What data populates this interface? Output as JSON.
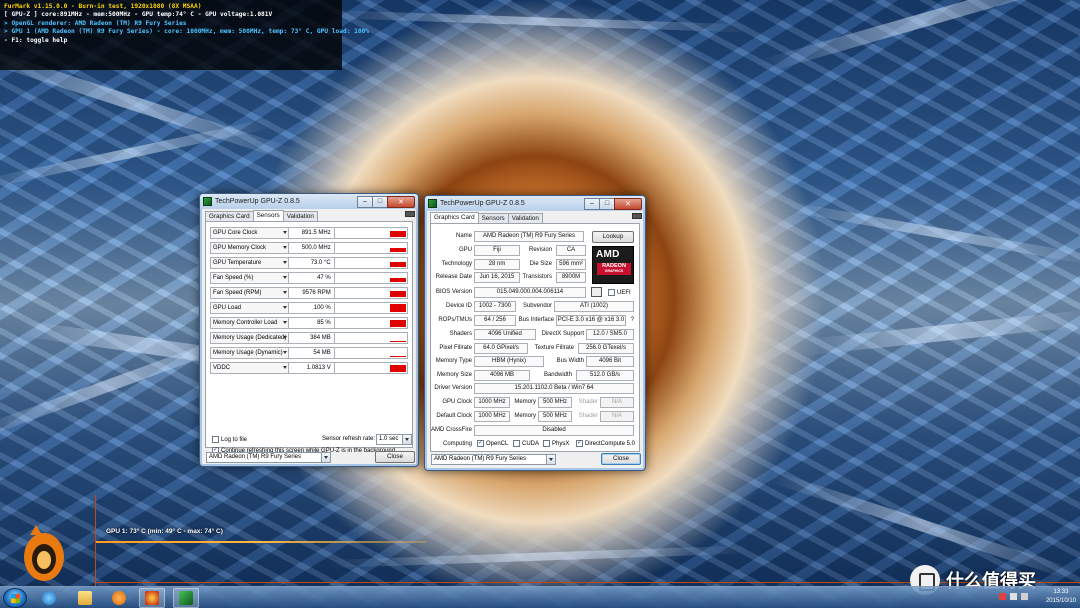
{
  "furmark": {
    "title": "FurMark v1.15.0.0 - Burn-in test, 1920x1080 (8X MSAA)",
    "line_gpuz": "[ GPU-Z ] core:891MHz - mem:500MHz - GPU temp:74° C - GPU voltage:1.081V",
    "line_renderer": "> OpenGL renderer: AMD Radeon (TM) R9 Fury Series",
    "line_gpu1": "> GPU 1 (AMD Radeon (TM) R9 Fury Series) - core: 1000MHz, mem: 500MHz, temp: 73° C, GPU load: 100%",
    "line_help": "- F1: toggle help",
    "graph_label": "GPU 1: 73° C (min: 49° C - max: 74° C)"
  },
  "gpuz_sensors": {
    "title": "TechPowerUp GPU-Z 0.8.5",
    "tabs": [
      "Graphics Card",
      "Sensors",
      "Validation"
    ],
    "active_tab": "Sensors",
    "rows": [
      {
        "name": "GPU Core Clock",
        "value": "891.5 MHz",
        "level": 0.75
      },
      {
        "name": "GPU Memory Clock",
        "value": "500.0 MHz",
        "level": 0.55
      },
      {
        "name": "GPU Temperature",
        "value": "73.0 °C",
        "level": 0.6
      },
      {
        "name": "Fan Speed (%)",
        "value": "47 %",
        "level": 0.5
      },
      {
        "name": "Fan Speed (RPM)",
        "value": "9576 RPM",
        "level": 0.8
      },
      {
        "name": "GPU Load",
        "value": "100 %",
        "level": 1.0
      },
      {
        "name": "Memory Controller Load",
        "value": "85 %",
        "level": 0.9
      },
      {
        "name": "Memory Usage (Dedicated)",
        "value": "384 MB",
        "level": 0.1
      },
      {
        "name": "Memory Usage (Dynamic)",
        "value": "54 MB",
        "level": 0.05
      },
      {
        "name": "VDDC",
        "value": "1.0813 V",
        "level": 0.85
      }
    ],
    "log_to_file": "Log to file",
    "refresh_label": "Sensor refresh rate:",
    "refresh_value": "1.0 sec",
    "continue_refresh": "Continue refreshing this screen while GPU-Z is in the background",
    "device_select": "AMD Radeon (TM) R9 Fury Series",
    "close_label": "Close"
  },
  "gpuz_card": {
    "title": "TechPowerUp GPU-Z 0.8.5",
    "tabs": [
      "Graphics Card",
      "Sensors",
      "Validation"
    ],
    "active_tab": "Graphics Card",
    "name_label": "Name",
    "name_value": "AMD Radeon (TM) R9 Fury Series",
    "lookup_label": "Lookup",
    "gpu_label": "GPU",
    "gpu_value": "Fiji",
    "revision_label": "Revision",
    "revision_value": "CA",
    "technology_label": "Technology",
    "technology_value": "28 nm",
    "diesize_label": "Die Size",
    "diesize_value": "596 mm²",
    "release_label": "Release Date",
    "release_value": "Jun 16, 2015",
    "transistors_label": "Transistors",
    "transistors_value": "8900M",
    "bios_label": "BIOS Version",
    "bios_value": "015.049.000.004.006114",
    "uefi_label": "UEFI",
    "deviceid_label": "Device ID",
    "deviceid_value": "1002 - 7300",
    "subvendor_label": "Subvendor",
    "subvendor_value": "ATI (1002)",
    "rops_label": "ROPs/TMUs",
    "rops_value": "64 / 256",
    "businterface_label": "Bus Interface",
    "businterface_value": "PCI-E 3.0 x16 @ x16 3.0",
    "question_mark": "?",
    "shaders_label": "Shaders",
    "shaders_value": "4096 Unified",
    "directx_label": "DirectX Support",
    "directx_value": "12.0 / SM5.0",
    "pixelfill_label": "Pixel Fillrate",
    "pixelfill_value": "64.0 GPixel/s",
    "texturefill_label": "Texture Fillrate",
    "texturefill_value": "256.0 GTexel/s",
    "memtype_label": "Memory Type",
    "memtype_value": "HBM (Hynix)",
    "buswidth_label": "Bus Width",
    "buswidth_value": "4096 Bit",
    "memsize_label": "Memory Size",
    "memsize_value": "4096 MB",
    "bandwidth_label": "Bandwidth",
    "bandwidth_value": "512.0 GB/s",
    "driver_label": "Driver Version",
    "driver_value": "15.201.1102.0 Beta / Win7 64",
    "gpuclock_label": "GPU Clock",
    "gpuclock_value": "1000 MHz",
    "memory_label": "Memory",
    "gpuclock_mem_value": "500 MHz",
    "shader_label": "Shader",
    "na_value": "N/A",
    "defaultclock_label": "Default Clock",
    "defaultclock_value": "1000 MHz",
    "defaultclock_mem_value": "500 MHz",
    "crossfire_label": "AMD CrossFire",
    "crossfire_value": "Disabled",
    "computing_label": "Computing",
    "opencl_label": "OpenCL",
    "cuda_label": "CUDA",
    "physx_label": "PhysX",
    "directcompute_label": "DirectCompute 5.0",
    "logo_brand": "AMD",
    "logo_product": "RADEON",
    "logo_sub": "GRAPHICS",
    "device_select": "AMD Radeon (TM) R9 Fury Series",
    "close_label": "Close"
  },
  "taskbar": {
    "time": "13:33",
    "date": "2015/10/10"
  },
  "watermark": {
    "text": "什么值得买"
  }
}
